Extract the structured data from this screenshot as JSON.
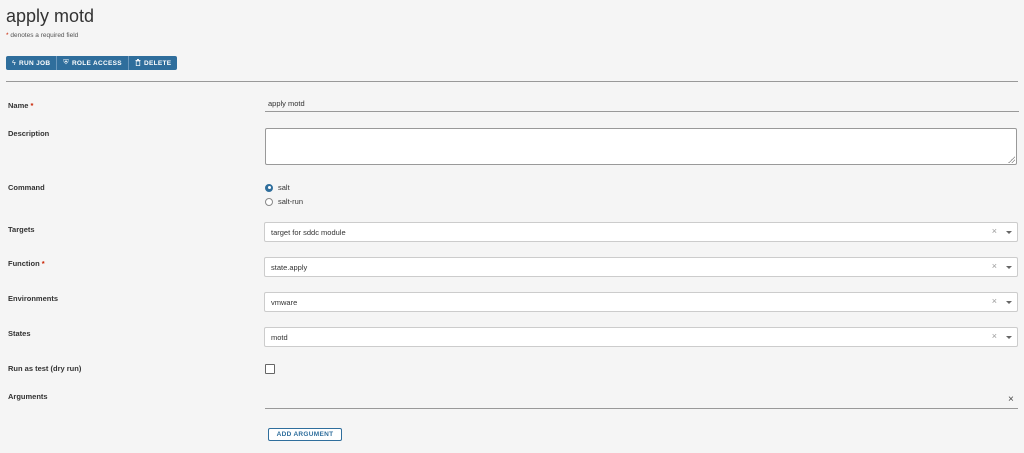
{
  "page": {
    "title": "apply motd",
    "required_star": "*",
    "required_note": "denotes a required field"
  },
  "toolbar": {
    "run_job": "RUN JOB",
    "role_access": "ROLE ACCESS",
    "delete": "DELETE"
  },
  "form": {
    "name": {
      "label": "Name",
      "value": "apply motd"
    },
    "description": {
      "label": "Description",
      "value": ""
    },
    "command": {
      "label": "Command",
      "options": [
        "salt",
        "salt-run"
      ],
      "selected": "salt"
    },
    "targets": {
      "label": "Targets",
      "value": "target for sddc module"
    },
    "function": {
      "label": "Function",
      "value": "state.apply"
    },
    "environments": {
      "label": "Environments",
      "value": "vmware"
    },
    "states": {
      "label": "States",
      "value": "motd"
    },
    "dry_run": {
      "label": "Run as test (dry run)",
      "checked": false
    },
    "arguments": {
      "label": "Arguments",
      "add_label": "ADD ARGUMENT"
    }
  },
  "colors": {
    "accent": "#2f6e9c",
    "required": "#c92100"
  },
  "icons": {
    "run_job": "lightning-icon",
    "role_access": "shield-icon",
    "delete": "trash-icon",
    "clear": "close-icon",
    "dropdown": "caret-down-icon"
  }
}
